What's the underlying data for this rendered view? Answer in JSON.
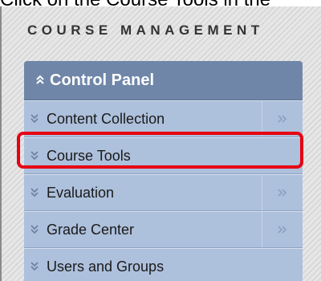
{
  "caption": "Click on the Course Tools in the",
  "section_title": "COURSE MANAGEMENT",
  "control_panel": {
    "title": "Control Panel",
    "items": [
      {
        "label": "Content Collection",
        "expandable": true
      },
      {
        "label": "Course Tools",
        "expandable": false,
        "highlighted": true
      },
      {
        "label": "Evaluation",
        "expandable": true
      },
      {
        "label": "Grade Center",
        "expandable": true
      },
      {
        "label": "Users and Groups",
        "expandable": false
      }
    ]
  },
  "colors": {
    "panel_header": "#6f86a8",
    "panel_body": "#adc0dc",
    "highlight": "#e60012"
  },
  "icons": {
    "collapse": "double-chevron-up-icon",
    "item": "double-chevron-down-icon",
    "expand": "double-chevron-right-icon"
  }
}
